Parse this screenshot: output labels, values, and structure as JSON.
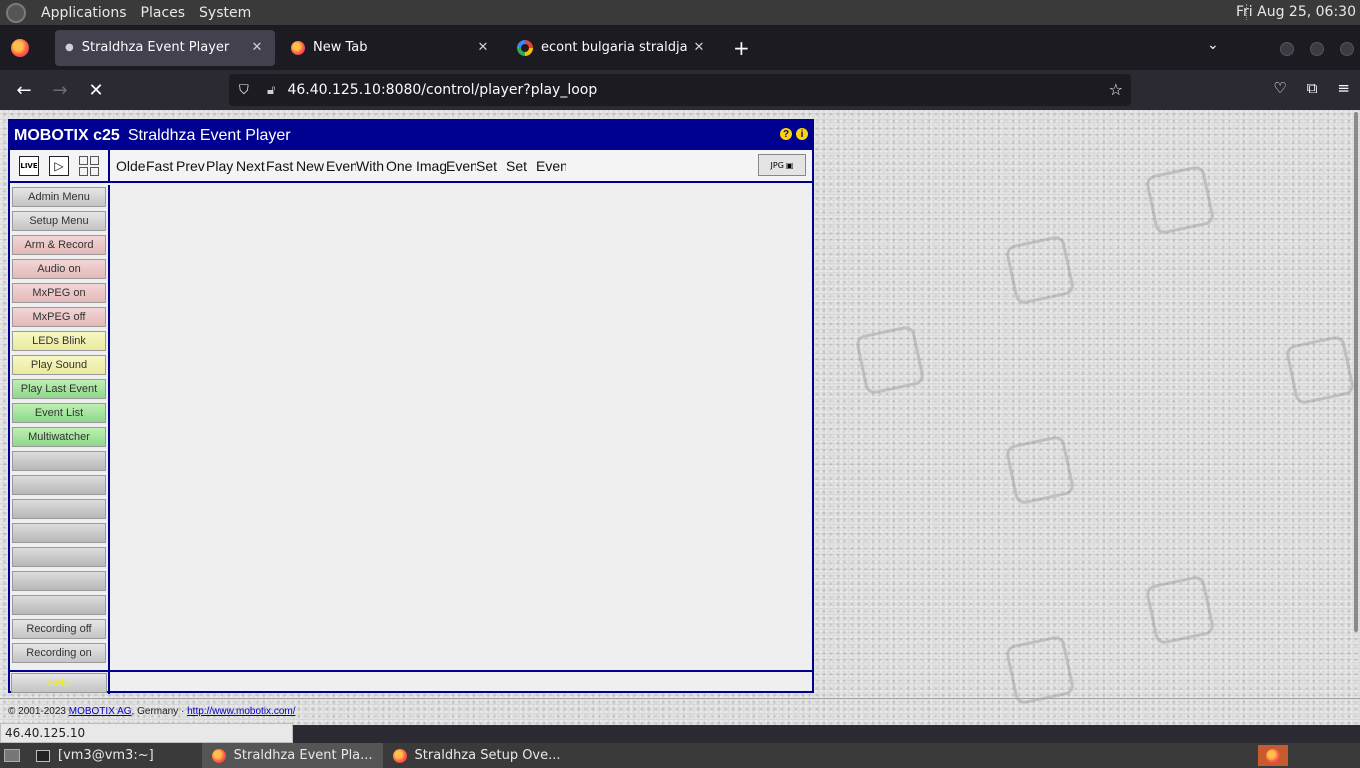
{
  "top_panel": {
    "menus": [
      "Applications",
      "Places",
      "System"
    ],
    "clock": "Fri Aug 25, 06:30"
  },
  "browser": {
    "tabs": [
      {
        "title": "Straldhza Event Player",
        "active": true
      },
      {
        "title": "New Tab",
        "active": false
      },
      {
        "title": "econt bulgaria straldja - Goo",
        "active": false
      }
    ],
    "url": "46.40.125.10:8080/control/player?play_loop"
  },
  "mobotix": {
    "brand": "MOBOTIX c25",
    "title": "Straldhza Event Player",
    "mode_buttons": {
      "live": "LIVE"
    },
    "toolbar_links": [
      "Olde",
      "Fast",
      "Prev",
      "Play",
      "Next",
      "Fast",
      "New",
      "Even",
      "With",
      "One",
      "Imag",
      "Even",
      "Set",
      "Set",
      "Even"
    ],
    "save_label": "JPG",
    "sidebar": [
      {
        "label": "Admin Menu",
        "style": "gray"
      },
      {
        "label": "Setup Menu",
        "style": "gray"
      },
      {
        "label": "Arm & Record",
        "style": "red"
      },
      {
        "label": "Audio on",
        "style": "red"
      },
      {
        "label": "MxPEG on",
        "style": "red"
      },
      {
        "label": "MxPEG off",
        "style": "red"
      },
      {
        "label": "LEDs Blink",
        "style": "yellow"
      },
      {
        "label": "Play Sound",
        "style": "yellow"
      },
      {
        "label": "Play Last Event",
        "style": "green"
      },
      {
        "label": "Event List",
        "style": "green"
      },
      {
        "label": "Multiwatcher",
        "style": "green"
      },
      {
        "label": "",
        "style": "empty"
      },
      {
        "label": "",
        "style": "empty"
      },
      {
        "label": "",
        "style": "empty"
      },
      {
        "label": "",
        "style": "empty"
      },
      {
        "label": "",
        "style": "empty"
      },
      {
        "label": "",
        "style": "empty"
      },
      {
        "label": "",
        "style": "empty"
      },
      {
        "label": "Recording off",
        "style": "gray"
      },
      {
        "label": "Recording on",
        "style": "gray"
      }
    ],
    "help_button": "Help",
    "copyright_prefix": "© 2001-2023",
    "company_link": "MOBOTIX AG",
    "copyright_mid": ", Germany ·",
    "website_link": "http://www.mobotix.com/"
  },
  "status_text": "46.40.125.10",
  "taskbar": {
    "items": [
      {
        "label": "[vm3@vm3:~]",
        "icon": "terminal-icon",
        "active": false
      },
      {
        "label": "Straldhza Event Pla...",
        "icon": "firefox-icon",
        "active": true
      },
      {
        "label": "Straldhza Setup Ove...",
        "icon": "firefox-icon",
        "active": false
      }
    ]
  }
}
